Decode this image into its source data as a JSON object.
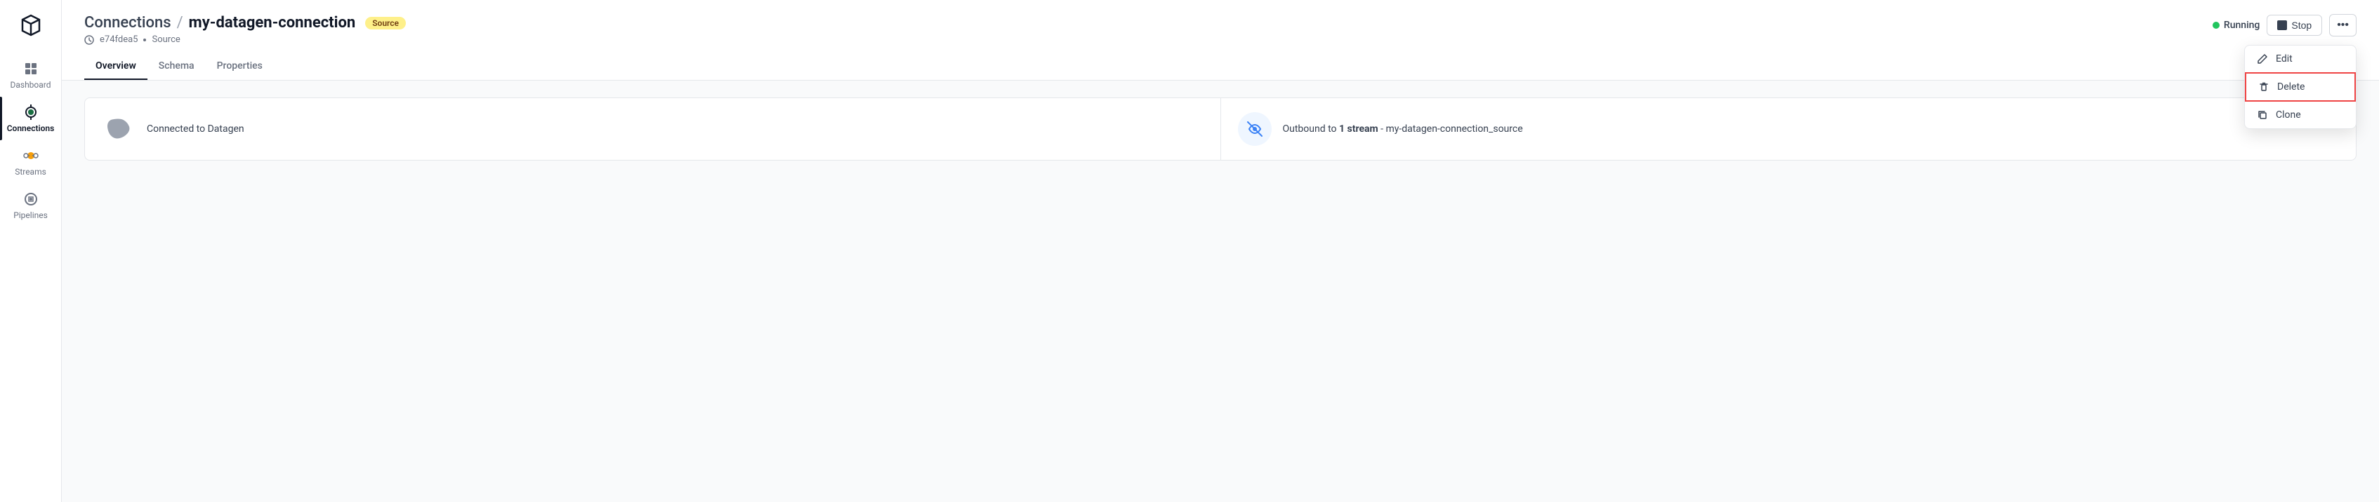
{
  "sidebar": {
    "logo_alt": "Logo",
    "items": [
      {
        "id": "dashboard",
        "label": "Dashboard",
        "icon": "grid-icon",
        "active": false
      },
      {
        "id": "connections",
        "label": "Connections",
        "icon": "connections-icon",
        "active": true
      },
      {
        "id": "streams",
        "label": "Streams",
        "icon": "streams-icon",
        "active": false
      },
      {
        "id": "pipelines",
        "label": "Pipelines",
        "icon": "pipelines-icon",
        "active": false
      }
    ]
  },
  "header": {
    "breadcrumb": "Connections",
    "separator": "/",
    "title": "my-datagen-connection",
    "badge": "Source",
    "subtitle_id": "e74fdea5",
    "subtitle_type": "Source"
  },
  "tabs": [
    {
      "id": "overview",
      "label": "Overview",
      "active": true
    },
    {
      "id": "schema",
      "label": "Schema",
      "active": false
    },
    {
      "id": "properties",
      "label": "Properties",
      "active": false
    }
  ],
  "actions": {
    "running_label": "Running",
    "stop_label": "Stop",
    "more_label": "..."
  },
  "dropdown": {
    "items": [
      {
        "id": "edit",
        "label": "Edit",
        "icon": "pencil-icon"
      },
      {
        "id": "delete",
        "label": "Delete",
        "icon": "trash-icon",
        "highlighted": true
      },
      {
        "id": "clone",
        "label": "Clone",
        "icon": "copy-icon"
      }
    ]
  },
  "cards": [
    {
      "id": "connected",
      "text": "Connected to Datagen",
      "icon_type": "datagen"
    },
    {
      "id": "outbound",
      "prefix": "Outbound to ",
      "highlight": "1 stream",
      "suffix": " - my-datagen-connection_source",
      "icon_type": "stream"
    }
  ]
}
